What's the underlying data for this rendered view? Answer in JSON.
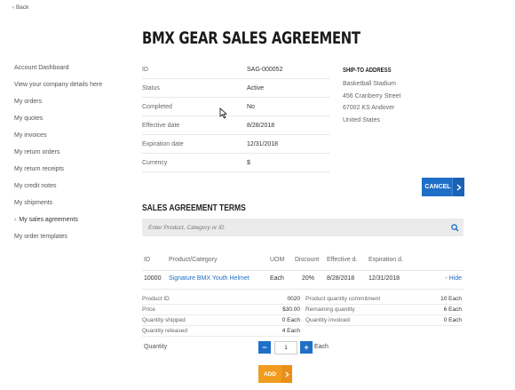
{
  "back_label": "‹ Back",
  "page_title": "BMX GEAR SALES AGREEMENT",
  "sidebar": {
    "items": [
      {
        "label": "Account Dashboard",
        "active": false
      },
      {
        "label": "View your company details here",
        "active": false
      },
      {
        "label": "My orders",
        "active": false
      },
      {
        "label": "My quotes",
        "active": false
      },
      {
        "label": "My invoices",
        "active": false
      },
      {
        "label": "My return orders",
        "active": false
      },
      {
        "label": "My return receipts",
        "active": false
      },
      {
        "label": "My credit notes",
        "active": false
      },
      {
        "label": "My shipments",
        "active": false
      },
      {
        "label": "My sales agreements",
        "active": true
      },
      {
        "label": "My order templates",
        "active": false
      }
    ]
  },
  "info": [
    {
      "key": "ID",
      "value": "SAG-000052"
    },
    {
      "key": "Status",
      "value": "Active"
    },
    {
      "key": "Completed",
      "value": "No"
    },
    {
      "key": "Effective date",
      "value": "8/28/2018"
    },
    {
      "key": "Expiration date",
      "value": "12/31/2018"
    },
    {
      "key": "Currency",
      "value": "$"
    }
  ],
  "ship_to": {
    "heading": "SHIP-TO ADDRESS",
    "lines": [
      "Basketball Stadium",
      "456 Cranberry Street",
      "67002 KS Andover",
      "United States"
    ]
  },
  "cancel_label": "CANCEL",
  "terms": {
    "heading": "SALES AGREEMENT TERMS",
    "search_placeholder": "Enter Product, Category or ID",
    "columns": [
      "ID",
      "Product/Category",
      "UOM",
      "Discount",
      "Effective d.",
      "Expiration d."
    ],
    "row": {
      "id": "10000",
      "product": "Signature BMX Youth Helmet",
      "uom": "Each",
      "discount": "20%",
      "effective": "8/28/2018",
      "expiration": "12/31/2018",
      "hide_label": "- Hide"
    },
    "details_left": [
      {
        "key": "Product ID",
        "value": "0020"
      },
      {
        "key": "Price",
        "value": "$30.00"
      },
      {
        "key": "Quantity shipped",
        "value": "0 Each"
      },
      {
        "key": "Quantity released",
        "value": "4 Each"
      }
    ],
    "details_right": [
      {
        "key": "Product quantity commitment",
        "value": "10 Each"
      },
      {
        "key": "Remaining quantity",
        "value": "6 Each"
      },
      {
        "key": "Quantity invoiced",
        "value": "0 Each"
      }
    ],
    "quantity_label": "Quantity",
    "quantity_value": "1",
    "quantity_unit": "Each",
    "add_label": "ADD"
  },
  "colors": {
    "primary": "#1f6fc8",
    "accent": "#f29c1f",
    "link": "#1f6fc8"
  }
}
